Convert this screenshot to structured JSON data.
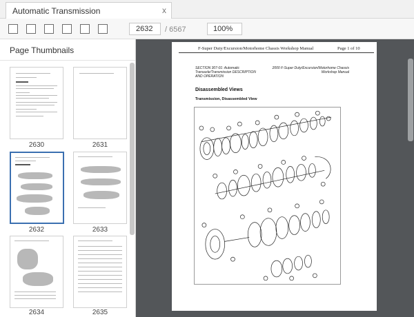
{
  "tab": {
    "title": "Automatic Transmission",
    "close": "x"
  },
  "toolbar": {
    "buttons": [
      {
        "icon": "toolbar-button-1-icon"
      },
      {
        "icon": "toolbar-button-2-icon"
      },
      {
        "icon": "toolbar-button-3-icon"
      },
      {
        "icon": "toolbar-button-4-icon"
      },
      {
        "icon": "toolbar-button-5-icon"
      },
      {
        "icon": "toolbar-button-6-icon"
      }
    ],
    "current_page": "2632",
    "total_pages": "/ 6567",
    "zoom": "100%"
  },
  "sidebar": {
    "title": "Page Thumbnails",
    "thumbnails": [
      {
        "label": "2630",
        "selected": false
      },
      {
        "label": "2631",
        "selected": false
      },
      {
        "label": "2632",
        "selected": true
      },
      {
        "label": "2633",
        "selected": false
      },
      {
        "label": "2634",
        "selected": false
      },
      {
        "label": "2635",
        "selected": false
      }
    ]
  },
  "document": {
    "header_center": "F-Super Duty/Excursion/Motorhome Chassis Workshop Manual",
    "header_right": "Page 1 of 10",
    "section_left": "SECTION 307-01: Automatic Transaxle/Transmission DESCRIPTION AND OPERATION",
    "section_right": "2000 F-Super Duty/Excursion/Motorhome Chassis Workshop Manual",
    "heading": "Disassembled Views",
    "subheading": "Transmission, Disassembled View"
  },
  "colors": {
    "viewer_background": "#535659",
    "selection_border": "#3a6fb0",
    "toolbar_background": "#f7f7f7"
  }
}
